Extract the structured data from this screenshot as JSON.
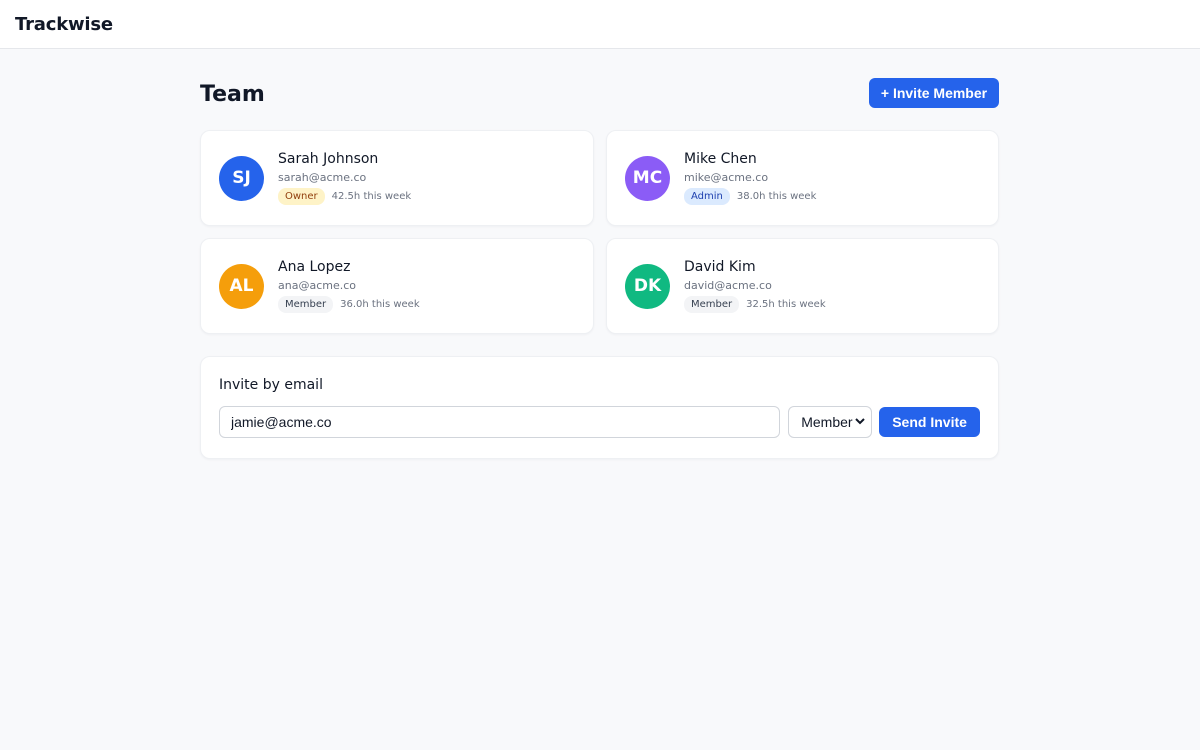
{
  "app": {
    "brand": "Trackwise"
  },
  "page": {
    "title": "Team",
    "invite_button": "+ Invite Member"
  },
  "colors": {
    "accent": "#2563eb",
    "owner_badge_bg": "#fef3c7",
    "owner_badge_fg": "#92400e",
    "admin_badge_bg": "#dbeafe",
    "admin_badge_fg": "#1e40af",
    "member_badge_bg": "#f3f4f6",
    "member_badge_fg": "#374151"
  },
  "members": [
    {
      "initials": "SJ",
      "name": "Sarah Johnson",
      "email": "sarah@acme.co",
      "role": "Owner",
      "hours": "42.5h this week",
      "avatar_color": "#2563eb"
    },
    {
      "initials": "MC",
      "name": "Mike Chen",
      "email": "mike@acme.co",
      "role": "Admin",
      "hours": "38.0h this week",
      "avatar_color": "#8b5cf6"
    },
    {
      "initials": "AL",
      "name": "Ana Lopez",
      "email": "ana@acme.co",
      "role": "Member",
      "hours": "36.0h this week",
      "avatar_color": "#f59e0b"
    },
    {
      "initials": "DK",
      "name": "David Kim",
      "email": "david@acme.co",
      "role": "Member",
      "hours": "32.5h this week",
      "avatar_color": "#10b981"
    }
  ],
  "invite": {
    "title": "Invite by email",
    "email_value": "jamie@acme.co",
    "role_selected": "Member",
    "send_label": "Send Invite",
    "chevron_icon": "chevron-down-icon"
  }
}
